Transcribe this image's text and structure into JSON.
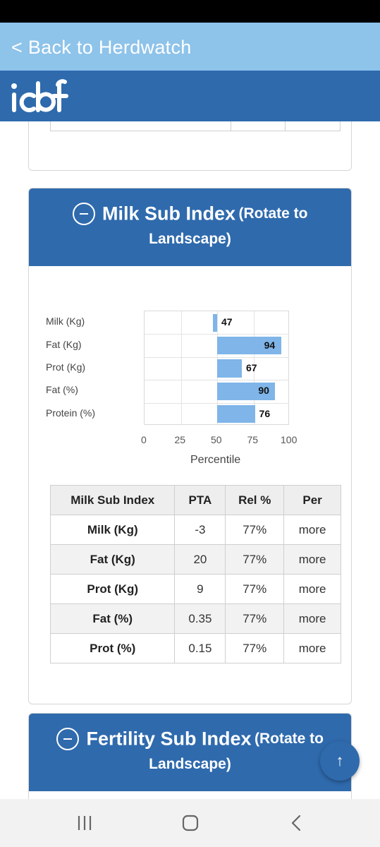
{
  "top_bar": {
    "back_label": "< Back to Herdwatch"
  },
  "brand": {
    "logo_text": "icbf",
    "color": "#2f6aad"
  },
  "milk_section": {
    "title": "Milk Sub Index",
    "rotate_hint_1": "(Rotate to",
    "rotate_hint_2": "Landscape)",
    "chart_data": {
      "type": "bar",
      "orientation": "horizontal",
      "categories": [
        "Milk (Kg)",
        "Fat (Kg)",
        "Prot (Kg)",
        "Fat (%)",
        "Protein (%)"
      ],
      "values": [
        47,
        94,
        67,
        90,
        76
      ],
      "base": 50,
      "xlabel": "Percentile",
      "xlim": [
        0,
        100
      ],
      "xticks": [
        "0",
        "25",
        "50",
        "75",
        "100"
      ],
      "bar_color": "#7fb5e8",
      "grid": true
    },
    "table": {
      "headers": [
        "Milk Sub Index",
        "PTA",
        "Rel %",
        "Per"
      ],
      "rows": [
        {
          "name": "Milk (Kg)",
          "pta": "-3",
          "rel": "77%",
          "per": "more"
        },
        {
          "name": "Fat (Kg)",
          "pta": "20",
          "rel": "77%",
          "per": "more"
        },
        {
          "name": "Prot (Kg)",
          "pta": "9",
          "rel": "77%",
          "per": "more"
        },
        {
          "name": "Fat (%)",
          "pta": "0.35",
          "rel": "77%",
          "per": "more"
        },
        {
          "name": "Prot (%)",
          "pta": "0.15",
          "rel": "77%",
          "per": "more"
        }
      ]
    }
  },
  "fertility_section": {
    "title": "Fertility Sub Index",
    "rotate_hint_1": "(Rotate to",
    "rotate_hint_2": "Landscape)"
  },
  "fab": {
    "icon": "arrow-up-icon",
    "glyph": "↑"
  },
  "nav": {
    "recents_icon": "recents-icon",
    "home_icon": "home-icon",
    "back_icon": "back-icon"
  }
}
